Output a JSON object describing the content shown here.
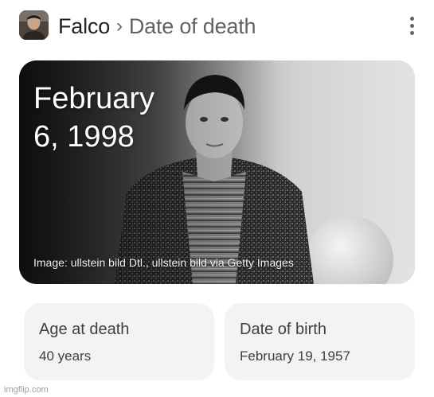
{
  "header": {
    "entity": "Falco",
    "separator": "›",
    "attribute": "Date of death",
    "more_icon": "more-vert-icon"
  },
  "hero": {
    "date_line1": "February",
    "date_line2": "6, 1998",
    "credit": "Image: ullstein bild Dtl., ullstein bild via Getty Images"
  },
  "cards": [
    {
      "label": "Age at death",
      "value": "40 years"
    },
    {
      "label": "Date of birth",
      "value": "February 19, 1957"
    }
  ],
  "watermark": "imgflip.com",
  "colors": {
    "title": "#202124",
    "secondary": "#5f6368",
    "card_bg": "#f1f3f4"
  }
}
